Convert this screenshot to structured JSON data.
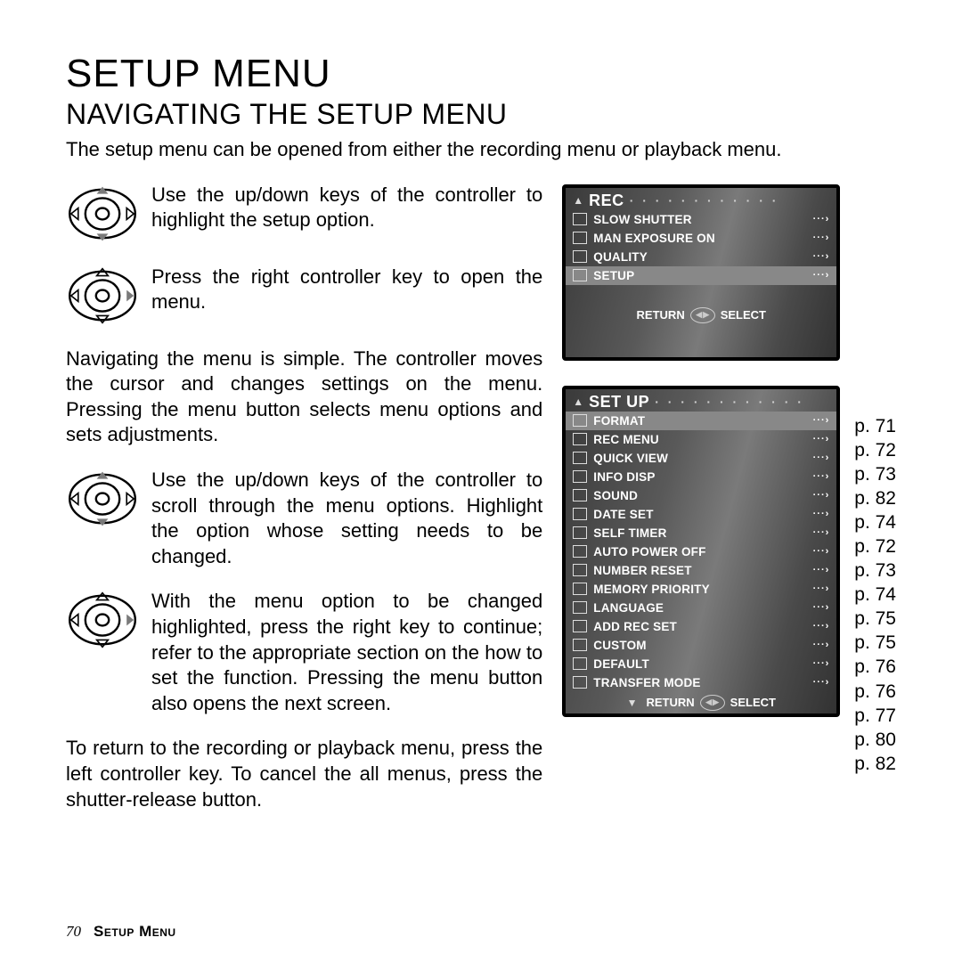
{
  "title": "SETUP MENU",
  "subtitle": "NAVIGATING THE SETUP MENU",
  "intro": "The setup menu can be opened from either the recording menu or playback menu.",
  "steps": {
    "s1": "Use the up/down keys of the controller to highlight the setup option.",
    "s2": "Press the right controller key to open the menu.",
    "s3": "Navigating the menu is simple. The controller moves the cursor and changes settings on the menu. Pressing the menu button selects menu options and sets adjustments.",
    "s4": "Use the up/down keys of the controller to scroll through the menu options. Highlight the option whose setting needs to be changed.",
    "s5": "With the menu option to be changed highlighted, press the right key to continue; refer to the appropriate section on the how to set the function. Pressing the menu button also opens the next screen.",
    "s6": "To return to the recording or playback menu, press the left controller key. To cancel the all menus, press the shutter-release button."
  },
  "screen1": {
    "header": "REC",
    "items": [
      {
        "label": "SLOW SHUTTER",
        "hi": false
      },
      {
        "label": "MAN EXPOSURE ON",
        "hi": false
      },
      {
        "label": "QUALITY",
        "hi": false
      },
      {
        "label": "SETUP",
        "hi": true
      }
    ],
    "return": "RETURN",
    "select": "SELECT"
  },
  "screen2": {
    "header": "SET UP",
    "items": [
      {
        "label": "FORMAT",
        "page": "p. 71",
        "hi": true
      },
      {
        "label": "REC MENU",
        "page": "p. 72",
        "hi": false
      },
      {
        "label": "QUICK VIEW",
        "page": "p. 73",
        "hi": false
      },
      {
        "label": "INFO DISP",
        "page": "p. 82",
        "hi": false
      },
      {
        "label": "SOUND",
        "page": "p. 74",
        "hi": false
      },
      {
        "label": "DATE SET",
        "page": "p. 72",
        "hi": false
      },
      {
        "label": "SELF TIMER",
        "page": "p. 73",
        "hi": false
      },
      {
        "label": "AUTO POWER OFF",
        "page": "p. 74",
        "hi": false
      },
      {
        "label": "NUMBER RESET",
        "page": "p. 75",
        "hi": false
      },
      {
        "label": "MEMORY PRIORITY",
        "page": "p. 75",
        "hi": false
      },
      {
        "label": "LANGUAGE",
        "page": "p. 76",
        "hi": false
      },
      {
        "label": "ADD REC SET",
        "page": "p. 76",
        "hi": false
      },
      {
        "label": "CUSTOM",
        "page": "p. 77",
        "hi": false
      },
      {
        "label": "DEFAULT",
        "page": "p. 80",
        "hi": false
      },
      {
        "label": "TRANSFER MODE",
        "page": "p. 82",
        "hi": false
      }
    ],
    "return": "RETURN",
    "select": "SELECT"
  },
  "footer": {
    "pageno": "70",
    "section": "Setup Menu"
  }
}
